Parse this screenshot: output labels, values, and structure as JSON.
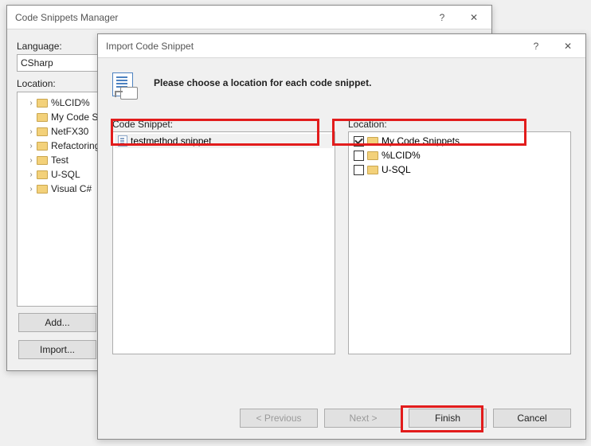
{
  "back_window": {
    "title": "Code Snippets Manager",
    "language_label": "Language:",
    "language_value": "CSharp",
    "location_label": "Location:",
    "folders": [
      "%LCID%",
      "My Code S",
      "NetFX30",
      "Refactoring",
      "Test",
      "U-SQL",
      "Visual C#"
    ],
    "add_btn": "Add...",
    "import_btn": "Import..."
  },
  "front_window": {
    "title": "Import Code Snippet",
    "instruction": "Please choose a location for each code snippet.",
    "snippet_label": "Code Snippet:",
    "location_label": "Location:",
    "snippet_items": [
      "testmethod.snippet"
    ],
    "location_items": [
      {
        "label": "My Code Snippets",
        "checked": true
      },
      {
        "label": "%LCID%",
        "checked": false
      },
      {
        "label": "U-SQL",
        "checked": false
      }
    ],
    "prev_btn": "< Previous",
    "next_btn": "Next >",
    "finish_btn": "Finish",
    "cancel_btn": "Cancel"
  }
}
